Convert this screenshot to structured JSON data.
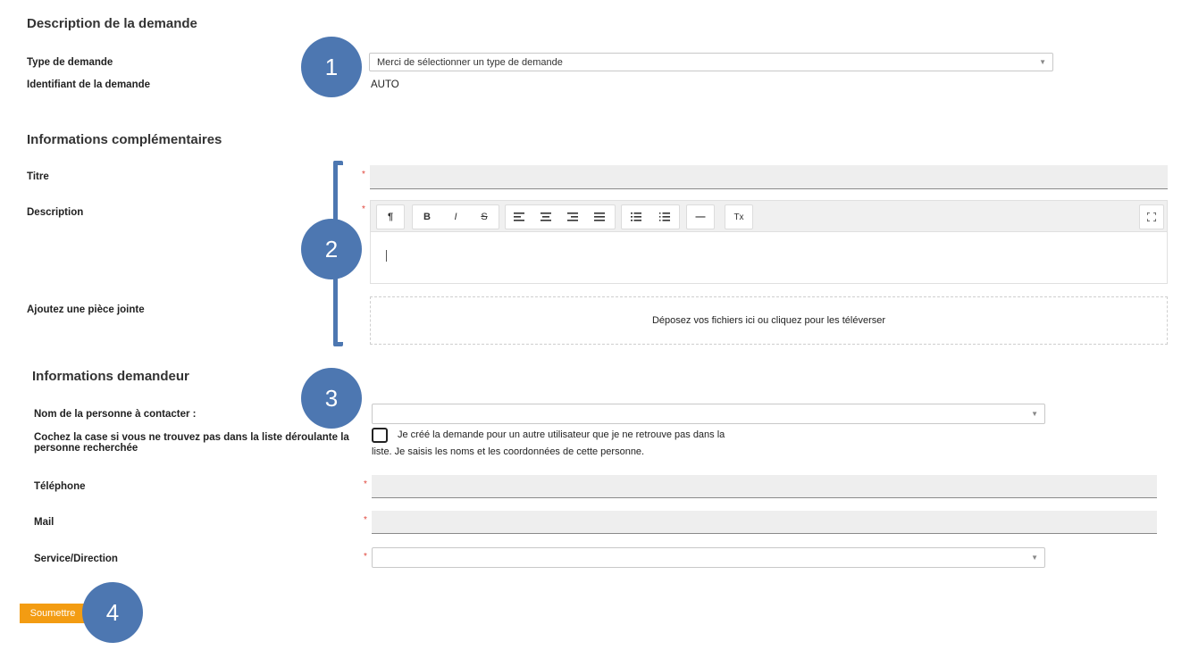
{
  "description_section": {
    "title": "Description de la demande",
    "type_label": "Type de demande",
    "type_placeholder": "Merci de sélectionner un type de demande",
    "id_label": "Identifiant de la demande",
    "id_value": "AUTO"
  },
  "complementary_section": {
    "title": "Informations complémentaires",
    "title_label": "Titre",
    "description_label": "Description",
    "attachment_label": "Ajoutez une pièce jointe",
    "dropzone_text": "Déposez vos fichiers ici ou cliquez pour les téléverser",
    "required_mark": "*"
  },
  "toolbar": {
    "paragraph": "¶",
    "bold": "B",
    "italic": "I",
    "strike": "S",
    "hr": "—",
    "clear": "Tx"
  },
  "requester_section": {
    "title": "Informations demandeur",
    "contact_label": "Nom de la personne à contacter :",
    "checkbox_label": "Cochez la case si vous ne trouvez pas dans la liste déroulante la personne recherchée",
    "checkbox_text_line1": "Je créé la demande pour un autre utilisateur que je ne retrouve pas dans la",
    "checkbox_text_line2": "liste. Je saisis les noms et les coordonnées de cette personne.",
    "phone_label": "Téléphone",
    "mail_label": "Mail",
    "service_label": "Service/Direction"
  },
  "submit_label": "Soumettre",
  "callouts": {
    "c1": "1",
    "c2": "2",
    "c3": "3",
    "c4": "4"
  },
  "colors": {
    "callout": "#4d77b1",
    "submit": "#f39c12",
    "required": "#e0453b"
  }
}
